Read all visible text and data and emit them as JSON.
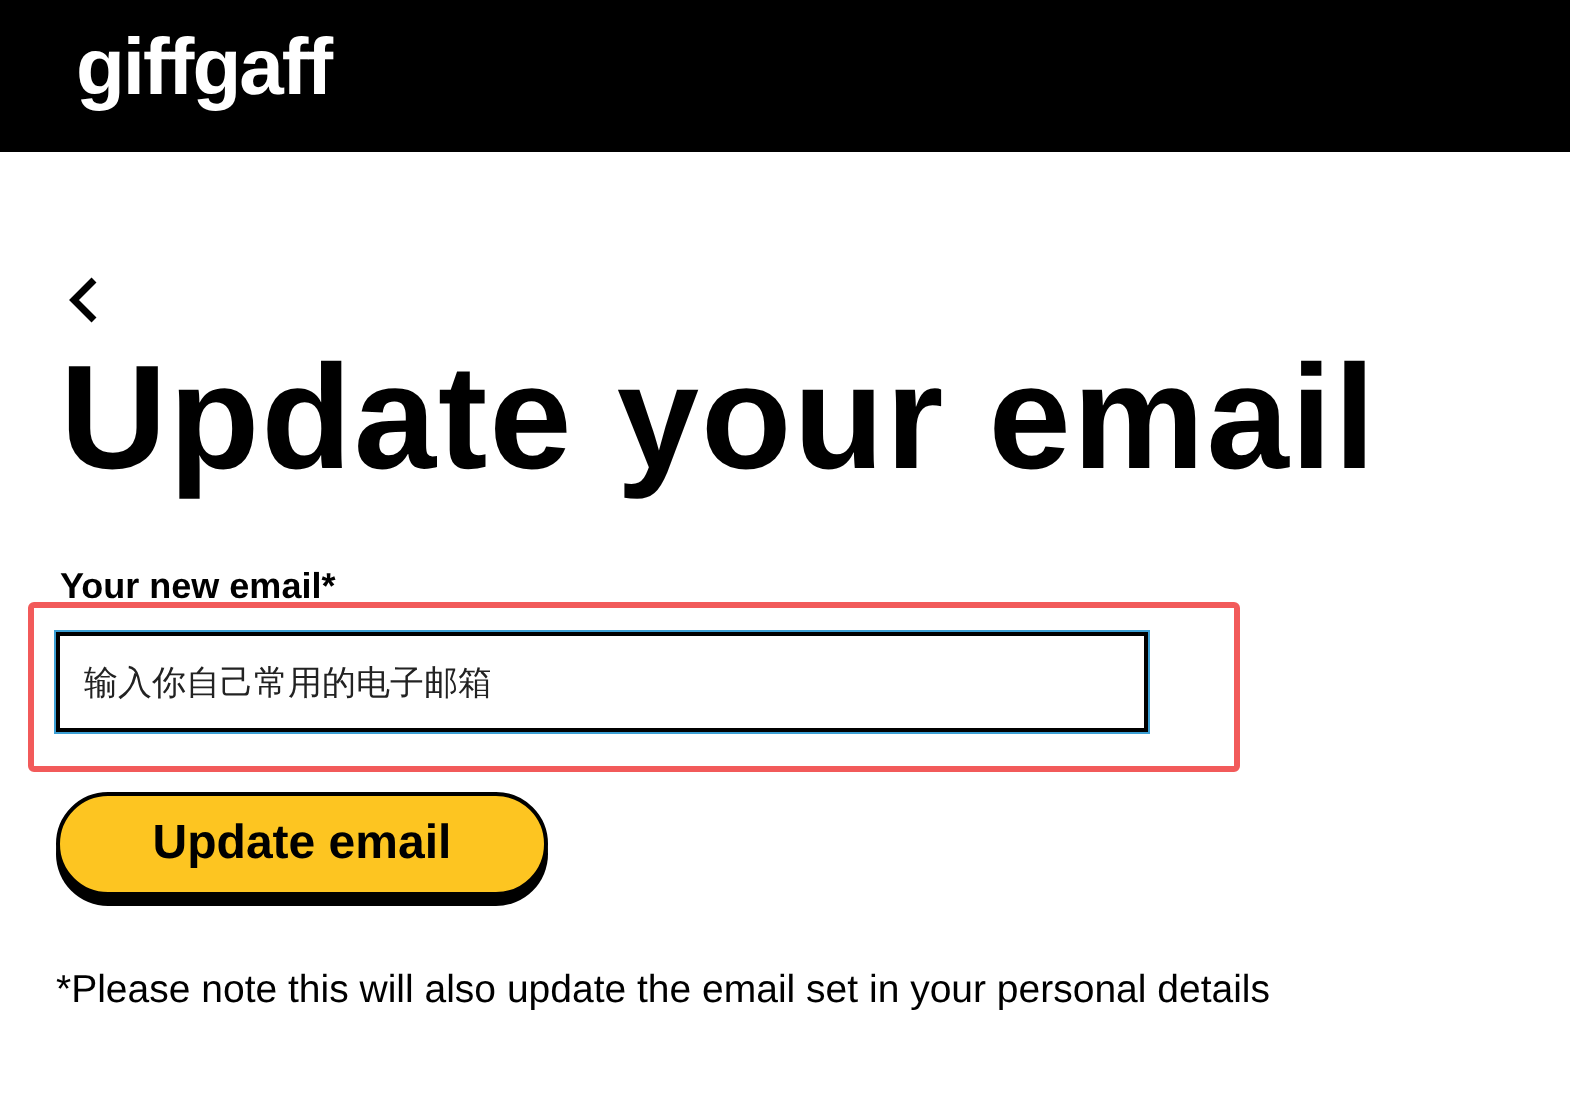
{
  "header": {
    "logo": "giffgaff"
  },
  "title": "Update your email",
  "email_field": {
    "label": "Your new email*",
    "value": "输入你自己常用的电子邮箱",
    "highlighted": true
  },
  "submit_button": "Update email",
  "note": "*Please note this will also update the email set in your personal details"
}
